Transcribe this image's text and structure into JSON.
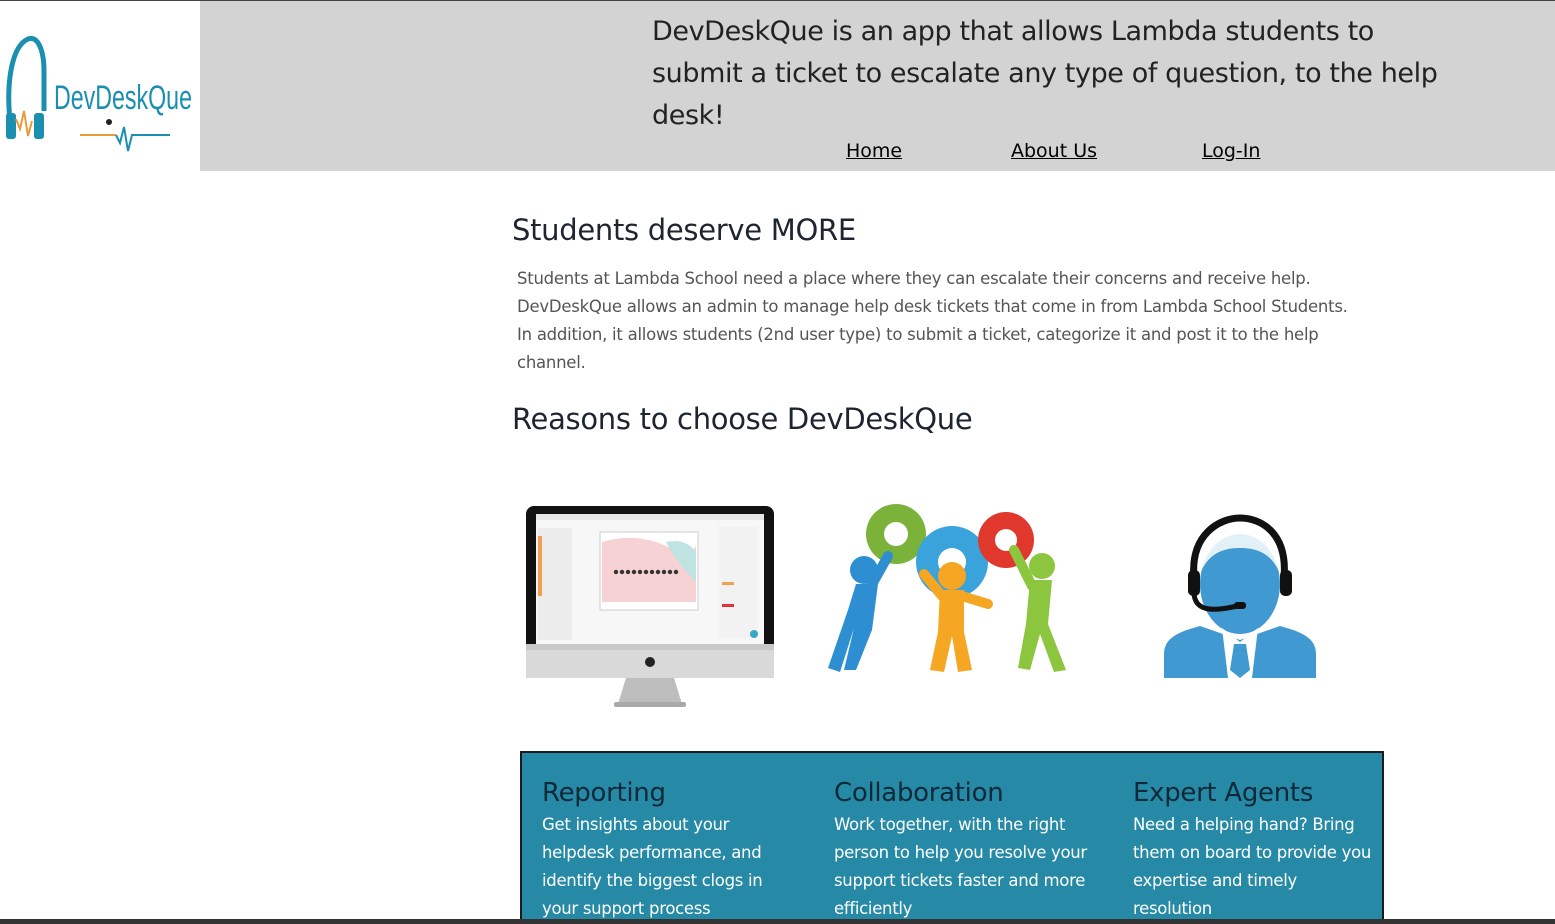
{
  "logo": {
    "text": "DevDeskQue",
    "icon": "headset-logo-icon"
  },
  "header": {
    "tagline": "DevDeskQue is an app that allows Lambda students to submit a ticket to escalate any type of question, to the help desk!"
  },
  "nav": {
    "home": "Home",
    "about": "About Us",
    "login": "Log-In"
  },
  "intro": {
    "title": "Students deserve MORE",
    "body": "Students at Lambda School need a place where they can escalate their concerns and receive help. DevDeskQue allows an admin to manage help desk tickets that come in from Lambda School Students. In addition, it allows students (2nd user type) to submit a ticket, categorize it and post it to the help channel."
  },
  "reasons": {
    "title": "Reasons to choose DevDeskQue",
    "images": [
      "monitor-dashboard-illustration",
      "people-gears-illustration",
      "support-agent-headset-illustration"
    ]
  },
  "features": [
    {
      "title": "Reporting",
      "body": "Get insights about your helpdesk performance, and identify the biggest clogs in your support process"
    },
    {
      "title": "Collaboration",
      "body": "Work together, with the right person to help you resolve your support tickets faster and more efficiently"
    },
    {
      "title": "Expert Agents",
      "body": "Need a helping hand? Bring them on board to provide you expertise and timely resolution"
    }
  ],
  "colors": {
    "header_bg": "#d3d3d3",
    "features_bg": "#268aa6",
    "logo_teal": "#1a8fb0",
    "logo_orange": "#e89a3c"
  }
}
